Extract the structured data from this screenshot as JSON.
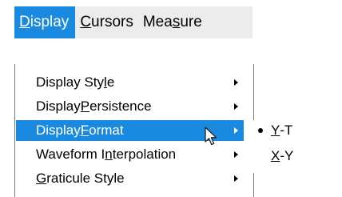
{
  "menubar": {
    "items": [
      {
        "accel": "D",
        "rest": "isplay",
        "pre": ""
      },
      {
        "accel": "C",
        "rest": "ursors",
        "pre": ""
      },
      {
        "pre": "Mea",
        "accel": "s",
        "rest": "ure"
      }
    ]
  },
  "menu": {
    "items": [
      {
        "pre": "Display Sty",
        "accel": "l",
        "post": "e"
      },
      {
        "pre": "Display ",
        "accel": "P",
        "post": "ersistence"
      },
      {
        "pre": "Display ",
        "accel": "F",
        "post": "ormat"
      },
      {
        "pre": "Waveform I",
        "accel": "n",
        "post": "terpolation"
      },
      {
        "pre": "",
        "accel": "G",
        "post": "raticule Style"
      }
    ]
  },
  "submenu": {
    "items": [
      {
        "pre": "",
        "accel": "Y",
        "post": "-T"
      },
      {
        "pre": "",
        "accel": "X",
        "post": "-Y"
      }
    ]
  },
  "colors": {
    "highlight": "#1a8ae0",
    "menubar_bg": "#ececec",
    "text": "#000000"
  },
  "icons": {
    "pointer": "mouse-pointer-icon",
    "submenu_arrow": "arrow-right-icon",
    "selected_marker": "bullet-icon"
  }
}
